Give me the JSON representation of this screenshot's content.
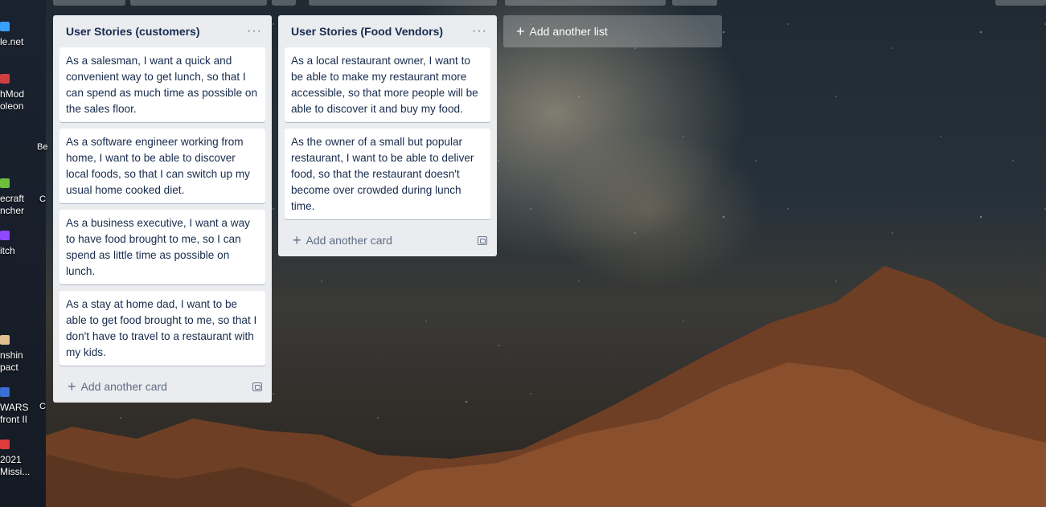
{
  "desktop": {
    "icons": [
      {
        "label": "le.net",
        "color": "#3aa0ff"
      },
      {
        "label": "hMod\noleon",
        "color": "#d04040"
      },
      {
        "label": "ecraft\nncher",
        "color": "#6cbf3c"
      },
      {
        "label": "itch",
        "color": "#9146ff"
      },
      {
        "label": "nshin\npact",
        "color": "#e0c090"
      },
      {
        "label": "WARS\nfront II",
        "color": "#3a6fd8"
      },
      {
        "label": "2021\nMissi...",
        "color": "#e03b3b"
      }
    ],
    "fragments": [
      "Be",
      "C",
      "C",
      "C"
    ]
  },
  "lists": [
    {
      "title": "User Stories (customers)",
      "menu_label": "···",
      "cards": [
        "As a salesman, I want a quick and convenient way to get lunch, so that I can spend as much time as possible on the sales floor.",
        "As a software engineer working from home, I want to be able to discover local foods, so that I can switch up my usual home cooked diet.",
        "As a business executive, I want a way to have food brought to me, so I can spend as little time as possible on lunch.",
        "As a stay at home dad, I want to be able to get food brought to me, so that I don't have to travel to a restaurant with my kids."
      ],
      "add_card_label": "Add another card"
    },
    {
      "title": "User Stories (Food Vendors)",
      "menu_label": "···",
      "cards": [
        "As a local restaurant owner, I want to be able to make my restaurant more accessible, so that more people will be able to discover it and buy my food.",
        "As the owner of a small but popular restaurant, I want to be able to deliver food, so that the restaurant doesn't become over crowded during lunch time."
      ],
      "add_card_label": "Add another card"
    }
  ],
  "add_list_label": "Add another list",
  "colors": {
    "list_bg": "#ebecf0",
    "card_bg": "#ffffff",
    "text": "#172b4d",
    "muted": "#5e6c84"
  }
}
